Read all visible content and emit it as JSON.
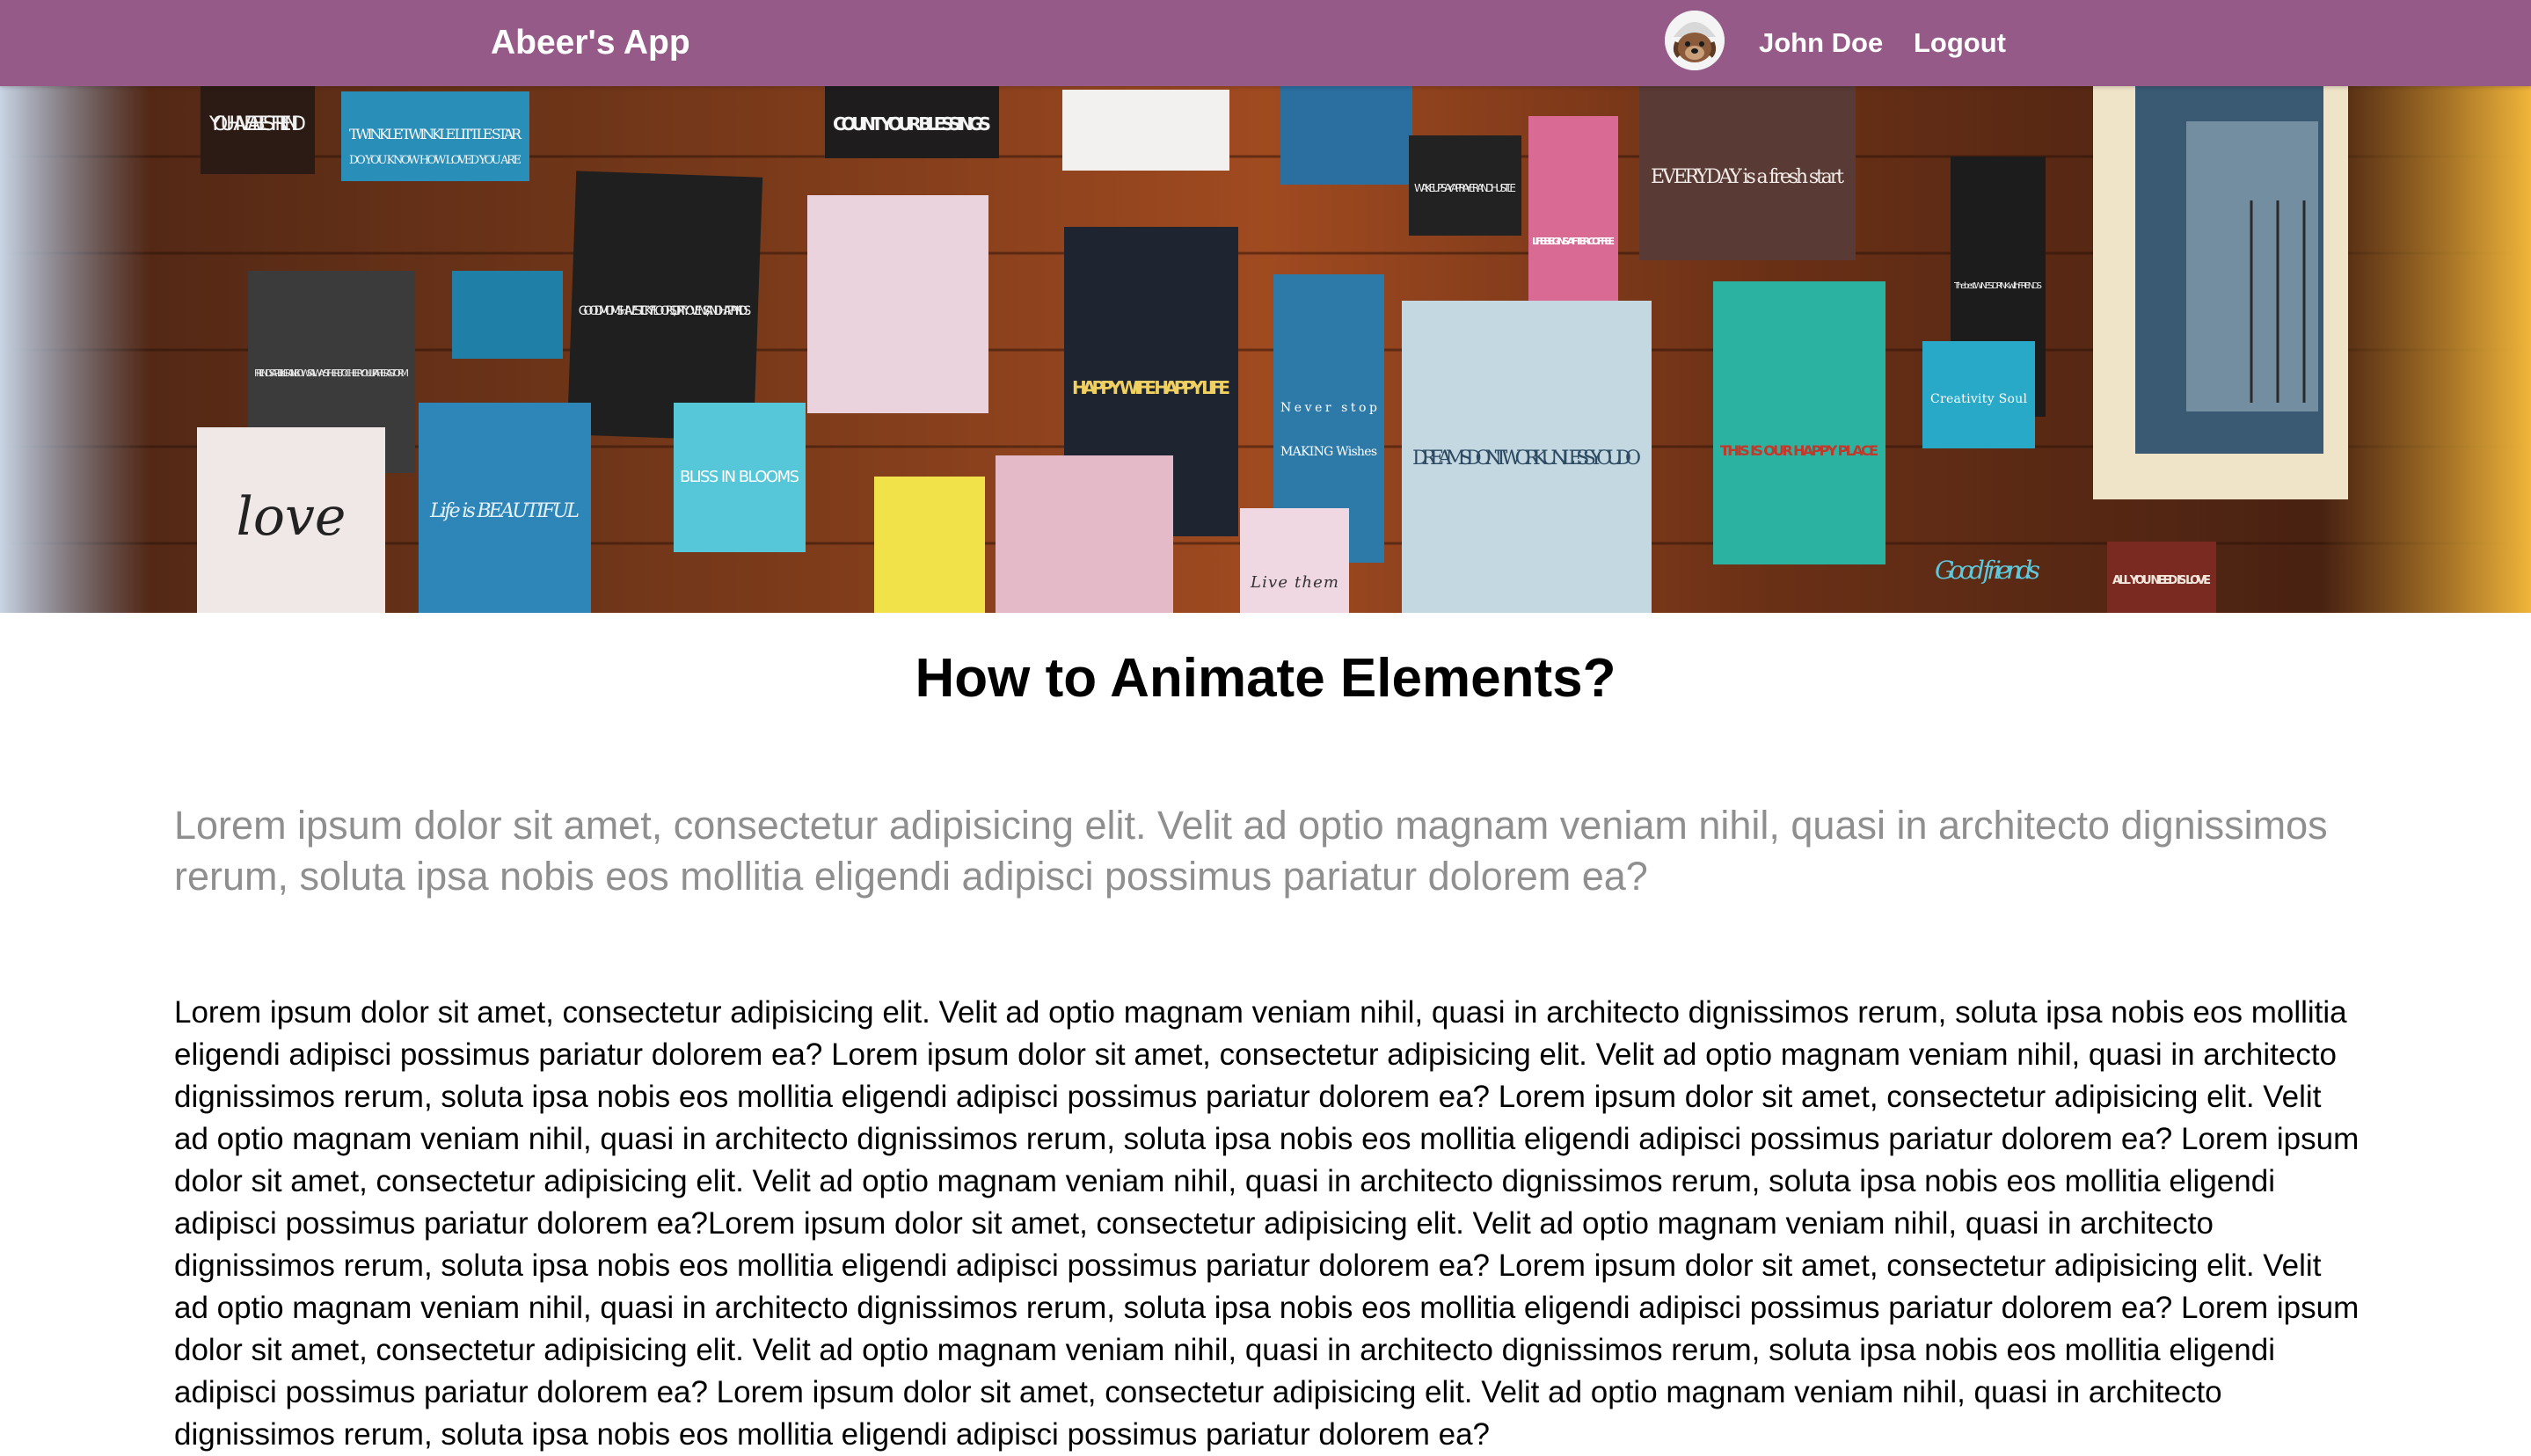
{
  "navbar": {
    "brand": "Abeer's App",
    "user_name": "John Doe",
    "logout_label": "Logout",
    "background_color": "#955a87"
  },
  "hero": {
    "signs": [
      "YOU HAVE A BEST FRIEND",
      "TWINKLE TWINKLE LITTLE STAR",
      "DO YOU KNOW HOW LOVED YOU ARE",
      "COUNT YOUR BLESSINGS",
      "GOOD MOMS HAVE STICKY FLOORS, DIRTY OVENS, AND HAPPY KIDS.",
      "FRIENDS ARE LIKE RAINBOWS ALWAYS THERE TO CHEER YOU UP AFTER A STORM",
      "HAPPY WIFE HAPPY LIFE",
      "WAKE UP SAY A PRAYER AND HUSTLE",
      "LIFE BEGINS AFTER COFFEE",
      "EVERYDAY is a fresh start",
      "The best WINES DRINK with FRIENDS",
      "DREAMS DON'T WORK UNLESS YOU DO",
      "THIS IS OUR HAPPY PLACE",
      "Creativity Soul",
      "love",
      "Life is BEAUTIFUL",
      "BLISS IN BLOOMS",
      "Live them",
      "ALL YOU NEED IS LOVE",
      "Good friends",
      "Never stop",
      "MAKING Wishes"
    ]
  },
  "article": {
    "title": "How to Animate Elements?",
    "lead": "Lorem ipsum dolor sit amet, consectetur adipisicing elit. Velit ad optio magnam veniam nihil, quasi in architecto dignissimos rerum, soluta ipsa nobis eos mollitia eligendi adipisci possimus pariatur dolorem ea?",
    "body": "Lorem ipsum dolor sit amet, consectetur adipisicing elit. Velit ad optio magnam veniam nihil, quasi in architecto dignissimos rerum, soluta ipsa nobis eos mollitia eligendi adipisci possimus pariatur dolorem ea? Lorem ipsum dolor sit amet, consectetur adipisicing elit. Velit ad optio magnam veniam nihil, quasi in architecto dignissimos rerum, soluta ipsa nobis eos mollitia eligendi adipisci possimus pariatur dolorem ea? Lorem ipsum dolor sit amet, consectetur adipisicing elit. Velit ad optio magnam veniam nihil, quasi in architecto dignissimos rerum, soluta ipsa nobis eos mollitia eligendi adipisci possimus pariatur dolorem ea? Lorem ipsum dolor sit amet, consectetur adipisicing elit. Velit ad optio magnam veniam nihil, quasi in architecto dignissimos rerum, soluta ipsa nobis eos mollitia eligendi adipisci possimus pariatur dolorem ea?Lorem ipsum dolor sit amet, consectetur adipisicing elit. Velit ad optio magnam veniam nihil, quasi in architecto dignissimos rerum, soluta ipsa nobis eos mollitia eligendi adipisci possimus pariatur dolorem ea? Lorem ipsum dolor sit amet, consectetur adipisicing elit. Velit ad optio magnam veniam nihil, quasi in architecto dignissimos rerum, soluta ipsa nobis eos mollitia eligendi adipisci possimus pariatur dolorem ea? Lorem ipsum dolor sit amet, consectetur adipisicing elit. Velit ad optio magnam veniam nihil, quasi in architecto dignissimos rerum, soluta ipsa nobis eos mollitia eligendi adipisci possimus pariatur dolorem ea? Lorem ipsum dolor sit amet, consectetur adipisicing elit. Velit ad optio magnam veniam nihil, quasi in architecto dignissimos rerum, soluta ipsa nobis eos mollitia eligendi adipisci possimus pariatur dolorem ea?"
  }
}
